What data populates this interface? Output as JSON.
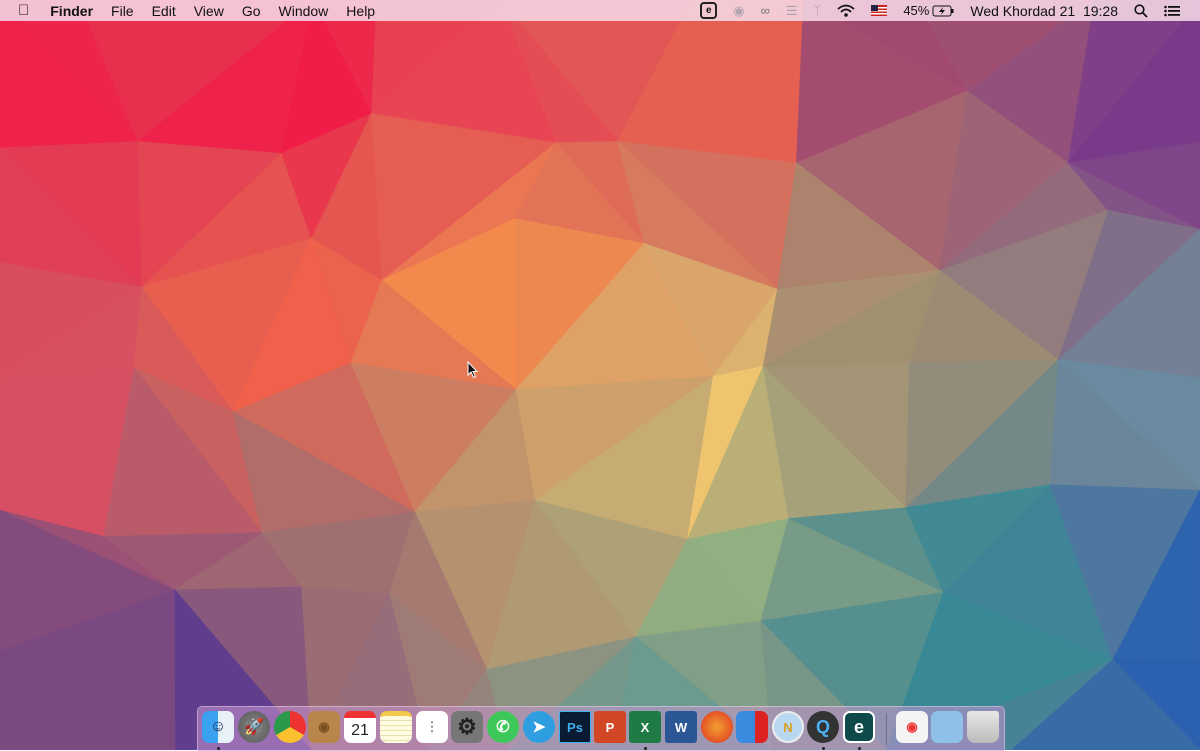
{
  "menubar": {
    "apple_icon": "apple-icon",
    "items": [
      "Finder",
      "File",
      "Edit",
      "View",
      "Go",
      "Window",
      "Help"
    ],
    "status": {
      "battery": "45%",
      "datetime": "Wed Khordad 21  19:28"
    },
    "status_icons": [
      "eset-icon",
      "record-icon",
      "creative-cloud-icon",
      "equalizer-icon",
      "bluetooth-icon",
      "wifi-icon",
      "us-flag-icon",
      "battery-charging-icon",
      "search-icon",
      "notification-center-icon"
    ]
  },
  "dock": {
    "calendar_day": "21",
    "apps": [
      {
        "name": "Finder",
        "icon": "finder-icon",
        "running": true
      },
      {
        "name": "Launchpad",
        "icon": "rocket-icon",
        "running": false
      },
      {
        "name": "Google Chrome",
        "icon": "chrome-icon",
        "running": false
      },
      {
        "name": "Contacts",
        "icon": "contacts-icon",
        "running": false
      },
      {
        "name": "Calendar",
        "icon": "calendar-icon",
        "running": false
      },
      {
        "name": "Notes",
        "icon": "notes-icon",
        "running": false
      },
      {
        "name": "Reminders",
        "icon": "reminders-icon",
        "running": false
      },
      {
        "name": "System Preferences",
        "icon": "gear-icon",
        "running": false
      },
      {
        "name": "WhatsApp",
        "icon": "whatsapp-icon",
        "running": false
      },
      {
        "name": "Telegram",
        "icon": "telegram-icon",
        "running": false
      },
      {
        "name": "Photoshop",
        "icon": "photoshop-icon",
        "label": "Ps",
        "running": false
      },
      {
        "name": "PowerPoint",
        "icon": "powerpoint-icon",
        "label": "P",
        "running": false
      },
      {
        "name": "Excel",
        "icon": "excel-icon",
        "label": "X",
        "running": true
      },
      {
        "name": "Word",
        "icon": "word-icon",
        "label": "W",
        "running": false
      },
      {
        "name": "Rocket",
        "icon": "red-rocket-icon",
        "running": false
      },
      {
        "name": "Parallels",
        "icon": "parallels-icon",
        "running": false
      },
      {
        "name": "N",
        "icon": "n-compass-icon",
        "label": "N",
        "running": false
      },
      {
        "name": "QuickTime",
        "icon": "quicktime-icon",
        "label": "Q",
        "running": true
      },
      {
        "name": "ESET",
        "icon": "eset-icon",
        "label": "e",
        "running": true
      }
    ],
    "stack": [
      {
        "name": "Chrome Apps",
        "icon": "chrome-folder-icon"
      },
      {
        "name": "Folder",
        "icon": "folder-icon"
      },
      {
        "name": "Trash",
        "icon": "trash-icon"
      }
    ]
  }
}
